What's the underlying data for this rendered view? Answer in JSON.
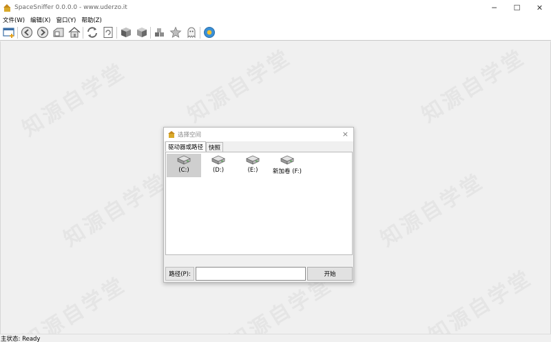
{
  "window": {
    "title": "SpaceSniffer 0.0.0.0 - www.uderzo.it",
    "minimize": "─",
    "maximize": "☐",
    "close": "✕"
  },
  "menu": [
    "文件(W)",
    "编辑(X)",
    "窗口(Y)",
    "帮助(Z)"
  ],
  "toolbar": {
    "icons": [
      "new-view-icon",
      "back-icon",
      "forward-icon",
      "zoom-in-icon",
      "home-icon",
      "refresh-icon",
      "rescan-icon",
      "cube-icon",
      "cube-alt-icon",
      "blocks-icon",
      "star-icon",
      "ghost-icon",
      "sun-icon"
    ]
  },
  "watermark": "知源自学堂",
  "status": {
    "text": "主状态: Ready"
  },
  "dialog": {
    "title": "选择空间",
    "close": "×",
    "tabs": [
      "驱动器或路径",
      "快照"
    ],
    "drives": [
      {
        "label": "(C:)",
        "selected": true
      },
      {
        "label": "(D:)",
        "selected": false
      },
      {
        "label": "(E:)",
        "selected": false
      },
      {
        "label": "新加卷 (F:)",
        "selected": false
      }
    ],
    "path_label": "路径(P):",
    "path_value": "",
    "start_label": "开始"
  },
  "colors": {
    "accent_icon": "#d9a92a",
    "selection": "#cfcfcf"
  }
}
